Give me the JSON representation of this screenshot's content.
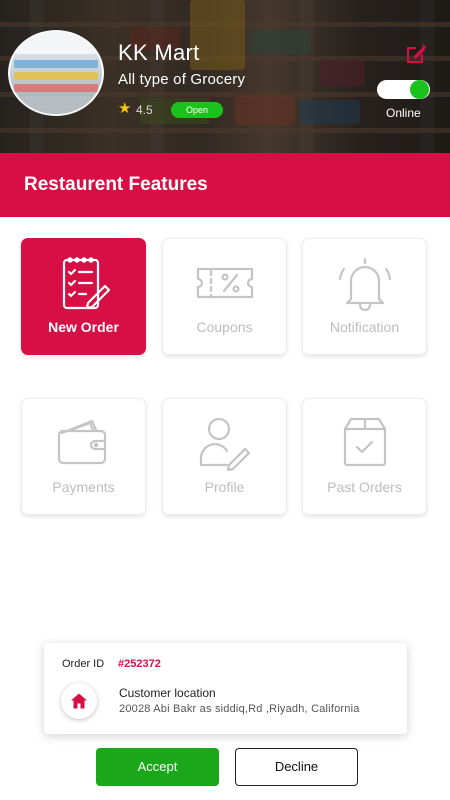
{
  "store": {
    "name": "KK Mart",
    "subtitle": "All type of Grocery",
    "rating": "4.5",
    "status_badge": "Open",
    "online_label": "Online",
    "online": true
  },
  "banner": {
    "title": "Restaurent Features"
  },
  "features": [
    {
      "label": "New Order",
      "icon": "clipboard-checklist-icon",
      "active": true
    },
    {
      "label": "Coupons",
      "icon": "coupon-icon",
      "active": false
    },
    {
      "label": "Notification",
      "icon": "bell-icon",
      "active": false
    },
    {
      "label": "Payments",
      "icon": "wallet-icon",
      "active": false
    },
    {
      "label": "Profile",
      "icon": "user-edit-icon",
      "active": false
    },
    {
      "label": "Past Orders",
      "icon": "box-check-icon",
      "active": false
    }
  ],
  "order": {
    "id_label": "Order ID",
    "id_value": "#252372",
    "location_title": "Customer location",
    "address": "20028 Abi Bakr as siddiq,Rd ,Riyadh, California",
    "accept_label": "Accept",
    "decline_label": "Decline"
  },
  "colors": {
    "accent": "#d80f45",
    "success": "#1cc21c",
    "accept": "#1aa81a",
    "inactive_icon": "#c4c4c4"
  }
}
